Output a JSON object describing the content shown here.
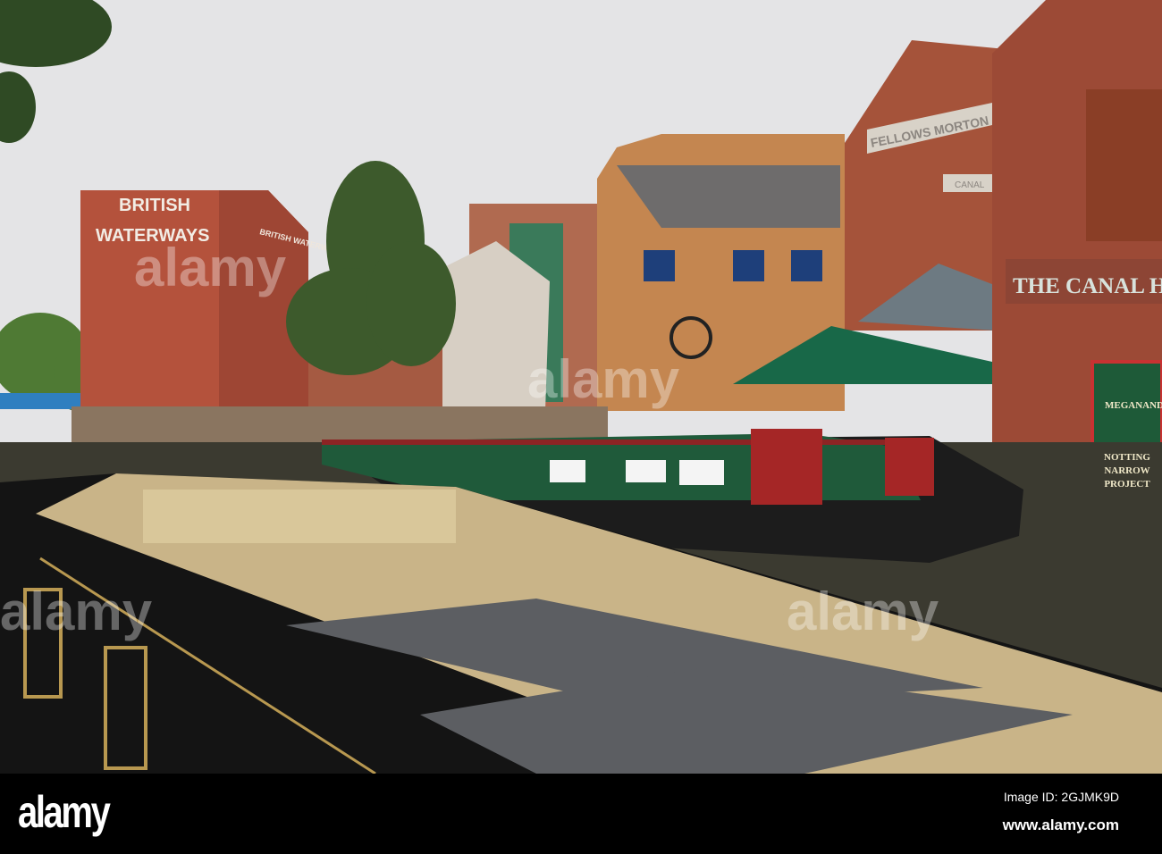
{
  "photo": {
    "signs": {
      "british_waterways_line1": "BRITISH",
      "british_waterways_line2": "WATERWAYS",
      "side_sign": "BRITISH WATERWAYS",
      "fellows_morton": "FELLOWS MORTON",
      "canal_small": "CANAL",
      "canal_house": "THE CANAL H",
      "door_title": "MEGANANDTONKS",
      "door_line1": "NOTTING",
      "door_line2": "NARROW",
      "door_line3": "PROJECT"
    },
    "watermark": "alamy"
  },
  "footer": {
    "logo": "alamy",
    "image_id": "Image ID: 2GJMK9D",
    "url": "www.alamy.com"
  },
  "colors": {
    "sky": "#e4e4e6",
    "brick": "#b4523c",
    "boat_green": "#1f5a3a",
    "roof_cream": "#c9b488"
  }
}
